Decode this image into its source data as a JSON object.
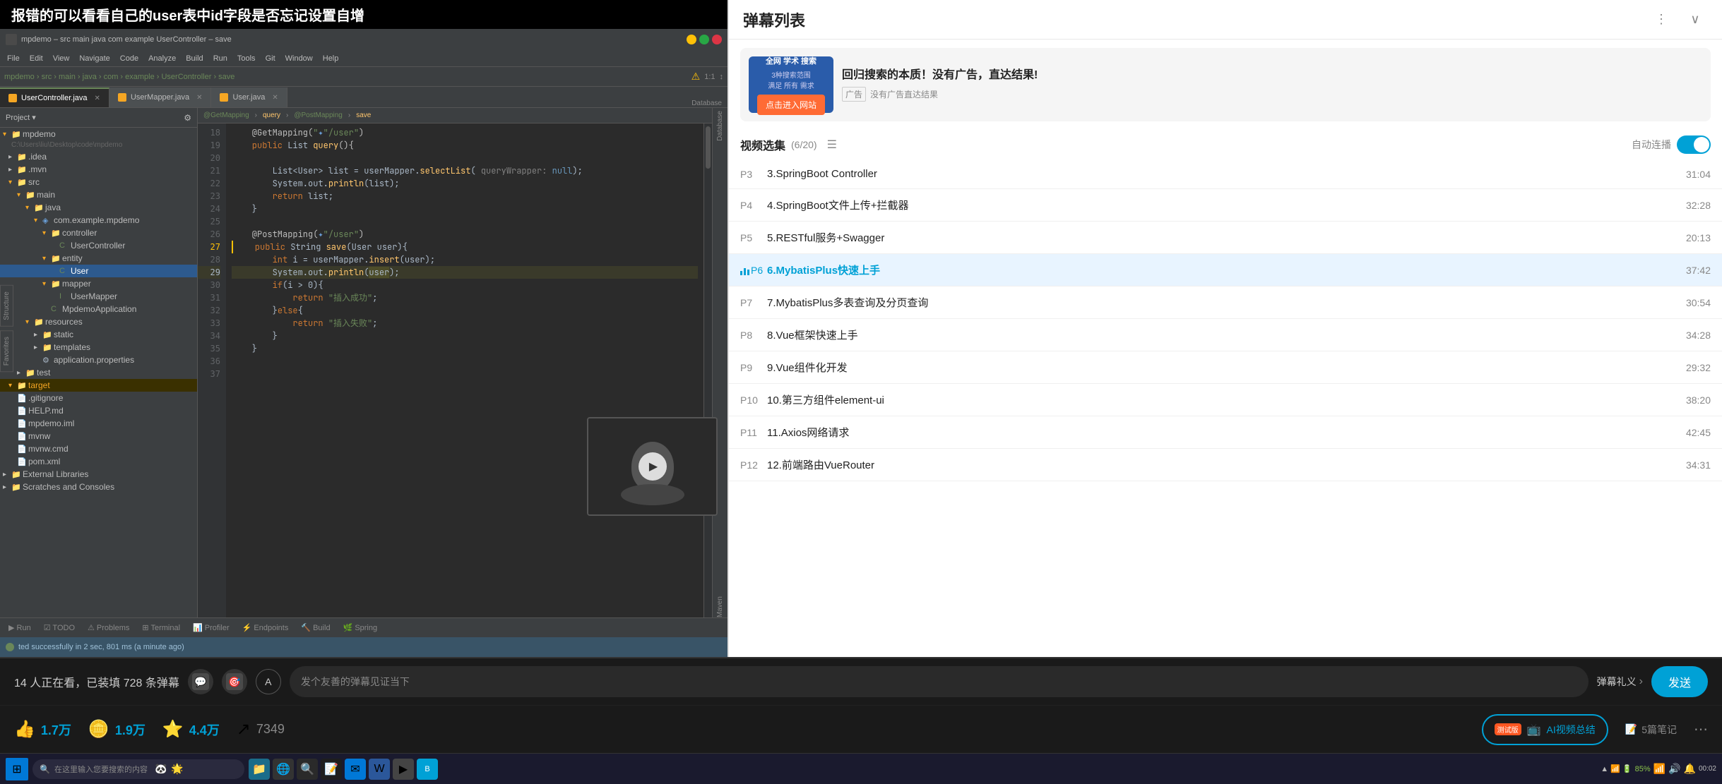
{
  "title_banner": {
    "text": "报错的可以看看自己的user表中id字段是否忘记设置自增"
  },
  "ide": {
    "title": "mpdemo – src main java com example",
    "menu_items": [
      "File",
      "Edit",
      "View",
      "Navigate",
      "Code",
      "Analyze",
      "Build",
      "Run",
      "Tools",
      "Git",
      "Window",
      "Help"
    ],
    "nav_path": "mpdemo > src > main > java > com > example > UserController > save",
    "tabs": [
      {
        "label": "UserController.java",
        "active": true
      },
      {
        "label": "UserMapper.java",
        "active": false
      },
      {
        "label": "User.java",
        "active": false
      }
    ],
    "project_tree": {
      "header": "Project ▾",
      "items": [
        {
          "label": "mpdemo",
          "indent": 0,
          "type": "folder",
          "expanded": true,
          "path": "C:\\Users\\liu\\Desktop\\code\\mpdemo"
        },
        {
          "label": ".idea",
          "indent": 1,
          "type": "folder",
          "expanded": false
        },
        {
          "label": ".mvn",
          "indent": 1,
          "type": "folder",
          "expanded": false
        },
        {
          "label": "src",
          "indent": 1,
          "type": "folder",
          "expanded": true
        },
        {
          "label": "main",
          "indent": 2,
          "type": "folder",
          "expanded": true
        },
        {
          "label": "java",
          "indent": 3,
          "type": "folder",
          "expanded": true
        },
        {
          "label": "com.example.mpdemo",
          "indent": 4,
          "type": "package",
          "expanded": true
        },
        {
          "label": "controller",
          "indent": 5,
          "type": "folder",
          "expanded": true
        },
        {
          "label": "UserController",
          "indent": 6,
          "type": "java",
          "expanded": false
        },
        {
          "label": "entity",
          "indent": 5,
          "type": "folder",
          "expanded": true
        },
        {
          "label": "User",
          "indent": 6,
          "type": "java",
          "selected": true
        },
        {
          "label": "mapper",
          "indent": 5,
          "type": "folder",
          "expanded": true
        },
        {
          "label": "UserMapper",
          "indent": 6,
          "type": "java"
        },
        {
          "label": "MpdemoApplication",
          "indent": 5,
          "type": "java"
        },
        {
          "label": "resources",
          "indent": 3,
          "type": "folder",
          "expanded": true
        },
        {
          "label": "static",
          "indent": 4,
          "type": "folder"
        },
        {
          "label": "templates",
          "indent": 4,
          "type": "folder"
        },
        {
          "label": "application.properties",
          "indent": 4,
          "type": "props"
        },
        {
          "label": "test",
          "indent": 2,
          "type": "folder"
        },
        {
          "label": "target",
          "indent": 1,
          "type": "folder",
          "color": "yellow"
        },
        {
          "label": ".gitignore",
          "indent": 1,
          "type": "file"
        },
        {
          "label": "HELP.md",
          "indent": 1,
          "type": "file"
        },
        {
          "label": "mpdemo.iml",
          "indent": 1,
          "type": "file"
        },
        {
          "label": "mvnw",
          "indent": 1,
          "type": "file"
        },
        {
          "label": "mvnw.cmd",
          "indent": 1,
          "type": "file"
        },
        {
          "label": "pom.xml",
          "indent": 1,
          "type": "xml"
        },
        {
          "label": "External Libraries",
          "indent": 0,
          "type": "folder"
        },
        {
          "label": "Scratches and Consoles",
          "indent": 0,
          "type": "folder"
        }
      ]
    },
    "code_lines": [
      {
        "num": 18,
        "content": "    @GetMapping(\"/user\")",
        "type": "annotation"
      },
      {
        "num": 19,
        "content": "    public List query(){",
        "type": "code"
      },
      {
        "num": 20,
        "content": ""
      },
      {
        "num": 21,
        "content": "        List<User> list = userMapper.selectList( queryWrapper: null);",
        "type": "code"
      },
      {
        "num": 22,
        "content": "        System.out.println(list);",
        "type": "code"
      },
      {
        "num": 23,
        "content": "        return list;",
        "type": "code"
      },
      {
        "num": 24,
        "content": "    }"
      },
      {
        "num": 25,
        "content": ""
      },
      {
        "num": 26,
        "content": "    @PostMapping(\"/user\")",
        "type": "annotation"
      },
      {
        "num": 27,
        "content": "    public String save(User user){",
        "type": "code"
      },
      {
        "num": 28,
        "content": "        int i = userMapper.insert(user);",
        "type": "code"
      },
      {
        "num": 29,
        "content": "        System.out.println(user);",
        "type": "code",
        "highlighted": true
      },
      {
        "num": 30,
        "content": "        if(i > 0){",
        "type": "code"
      },
      {
        "num": 31,
        "content": "            return \"插入成功\";",
        "type": "code"
      },
      {
        "num": 32,
        "content": "        }else{",
        "type": "code"
      },
      {
        "num": 33,
        "content": "            return \"插入失败\";",
        "type": "code"
      },
      {
        "num": 34,
        "content": "        }"
      },
      {
        "num": 35,
        "content": "    }"
      },
      {
        "num": 36,
        "content": ""
      },
      {
        "num": 37,
        "content": ""
      }
    ],
    "bottom_tabs": [
      "Run",
      "TODO",
      "Problems",
      "Terminal",
      "Profiler",
      "Endpoints",
      "Build",
      "Spring"
    ],
    "build_status": "ted successfully in 2 sec, 801 ms (a minute ago)"
  },
  "comment_bar": {
    "viewers": "14 人正在看，已装填 728 条弹幕",
    "input_placeholder": "发个友善的弹幕见证当下",
    "gift_text": "弹幕礼义",
    "gift_arrow": "›",
    "send_label": "发送"
  },
  "reaction_bar": {
    "like_count": "1.7万",
    "coin_count": "1.9万",
    "star_count": "4.4万",
    "share_count": "7349",
    "ai_badge": "测试版",
    "ai_label": "AI视频总结",
    "notes_count": "5篇笔记"
  },
  "right_panel": {
    "header_title": "弹幕列表",
    "ad": {
      "title": "回归搜索的本质！没有广告，直达结果!",
      "tag": "广告",
      "desc": "没有广告直达结果",
      "btn_label": "点击进入网站",
      "thumb_lines": [
        "全网 学术 搜索",
        "3种搜索范围",
        "满足 所有 需求"
      ]
    },
    "playlist": {
      "title": "视频选集",
      "count": "(6/20)",
      "auto_play_label": "自动连播",
      "items": [
        {
          "num": "P3",
          "title": "3.SpringBoot Controller",
          "duration": "31:04",
          "active": false,
          "playing": false
        },
        {
          "num": "P4",
          "title": "4.SpringBoot文件上传+拦截器",
          "duration": "32:28",
          "active": false,
          "playing": false
        },
        {
          "num": "P5",
          "title": "5.RESTful服务+Swagger",
          "duration": "20:13",
          "active": false,
          "playing": false
        },
        {
          "num": "P6",
          "title": "6.MybatisPlus快速上手",
          "duration": "37:42",
          "active": true,
          "playing": true
        },
        {
          "num": "P7",
          "title": "7.MybatisPlus多表查询及分页查询",
          "duration": "30:54",
          "active": false,
          "playing": false
        },
        {
          "num": "P8",
          "title": "8.Vue框架快速上手",
          "duration": "34:28",
          "active": false,
          "playing": false
        },
        {
          "num": "P9",
          "title": "9.Vue组件化开发",
          "duration": "29:32",
          "active": false,
          "playing": false
        },
        {
          "num": "P10",
          "title": "10.第三方组件element-ui",
          "duration": "38:20",
          "active": false,
          "playing": false
        },
        {
          "num": "P11",
          "title": "11.Axios网络请求",
          "duration": "42:45",
          "active": false,
          "playing": false
        },
        {
          "num": "P12",
          "title": "12.前端路由VueRouter",
          "duration": "34:31",
          "active": false,
          "playing": false
        }
      ]
    }
  },
  "taskbar": {
    "search_placeholder": "在这里输入您要搜索的内容",
    "time": "▲ 📶 🔋",
    "battery": "85%"
  }
}
